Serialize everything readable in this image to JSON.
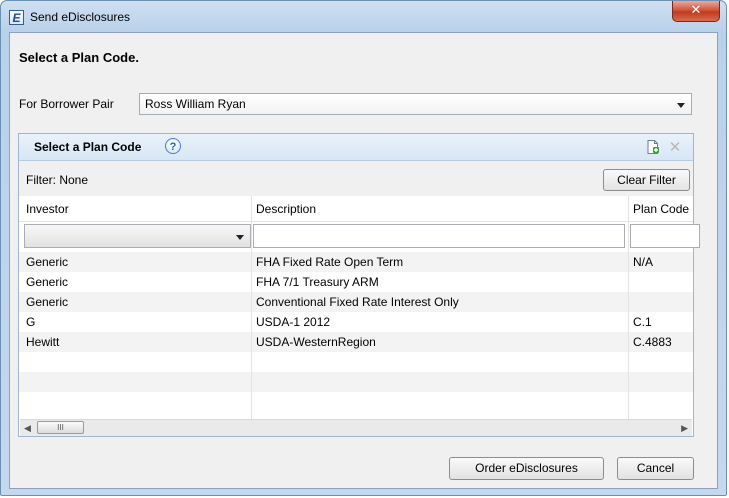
{
  "window": {
    "title": "Send eDisclosures",
    "app_icon_letter": "E",
    "close_glyph": "✕"
  },
  "dialog": {
    "heading": "Select a Plan Code.",
    "borrower_pair_label": "For Borrower Pair",
    "borrower_pair_value": "Ross William Ryan"
  },
  "panel": {
    "title": "Select a Plan Code",
    "help_glyph": "?",
    "icons": [
      "add-document-icon",
      "delete-icon"
    ],
    "filter_text": "Filter: None",
    "clear_filter_label": "Clear Filter"
  },
  "grid": {
    "columns": [
      "Investor",
      "Description",
      "Plan Code"
    ],
    "rows": [
      [
        "Generic",
        "FHA Fixed Rate Open Term",
        "N/A"
      ],
      [
        "Generic",
        "FHA 7/1 Treasury ARM",
        ""
      ],
      [
        "Generic",
        "Conventional Fixed Rate Interest Only",
        ""
      ],
      [
        "G",
        "USDA-1 2012",
        "C.1"
      ],
      [
        "Hewitt",
        "USDA-WesternRegion",
        "C.4883"
      ]
    ],
    "scroll_thumb_glyph": "III"
  },
  "footer": {
    "order_label": "Order eDisclosures",
    "cancel_label": "Cancel"
  },
  "colors": {
    "titlebar": "#b9d1ea",
    "panel_header": "#d7e6f5",
    "close_button": "#c23a1e"
  }
}
